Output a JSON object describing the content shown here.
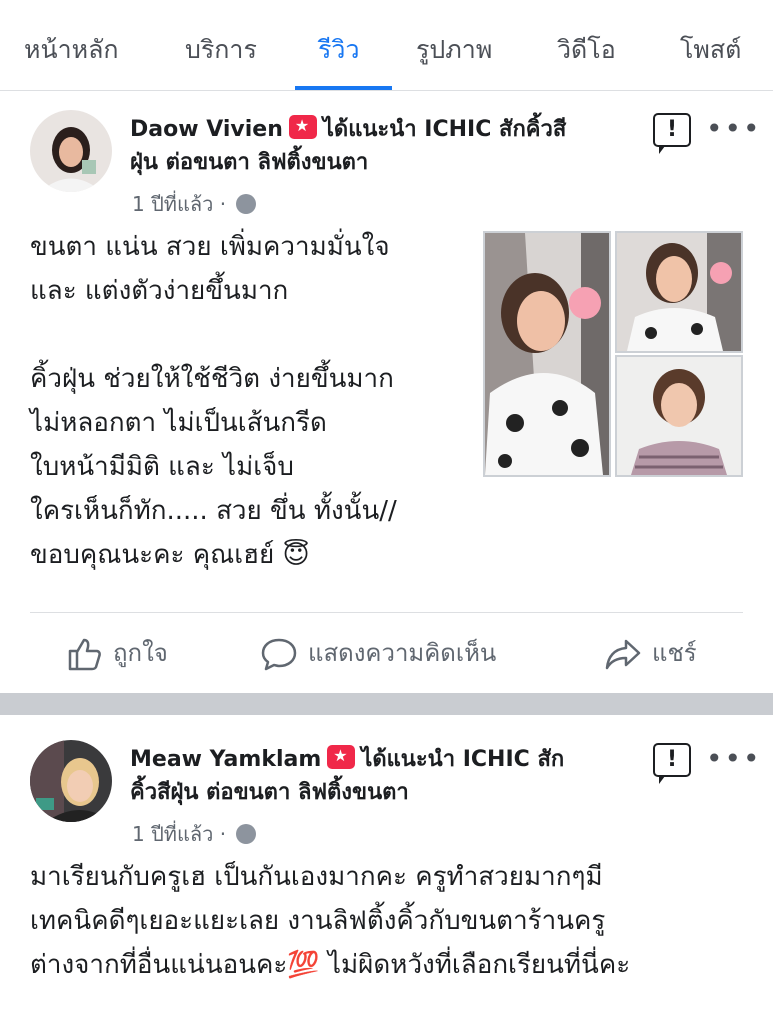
{
  "tabs": [
    {
      "label": "หน้าหลัก"
    },
    {
      "label": "บริการ"
    },
    {
      "label": "รีวิว",
      "active": true
    },
    {
      "label": "รูปภาพ"
    },
    {
      "label": "วิดีโอ"
    },
    {
      "label": "โพสต์"
    }
  ],
  "posts": [
    {
      "author": "Daow Vivien",
      "recommendation": "ได้แนะนำ ICHIC สักคิ้วสี",
      "recommendation_cont": "ฝุ่น ต่อขนตา ลิฟติ้งขนตา",
      "time": "1 ปีที่แล้ว ·",
      "text": "ขนตา แน่น สวย เพิ่มความมั่นใจ\nและ แต่งตัวง่ายขึ้นมาก\n\nคิ้วฝุ่น ช่วยให้ใช้ชีวิต ง่ายขึ้นมาก\nไม่หลอกตา ไม่เป็นเส้นกรีด\nใบหน้ามีมิติ และ ไม่เจ็บ\nใครเห็นก็ทัก..... สวย ขึ่น ทั้งนั้น//\nขอบคุณนะคะ คุณเฮย์ 😇",
      "photos": 3
    },
    {
      "author": "Meaw Yamklam",
      "recommendation": "ได้แนะนำ ICHIC สัก",
      "recommendation_cont": "คิ้วสีฝุ่น ต่อขนตา ลิฟติ้งขนตา",
      "time": "1 ปีที่แล้ว ·",
      "text": "มาเรียนกับครูเฮ เป็นกันเองมากคะ  ครูทำสวยมากๆมี\nเทคนิคดีๆเยอะแยะเลย งานลิฟติ้งคิ้วกับขนตาร้านครู\nต่างจากที่อื่นแน่นอนคะ💯 ไม่ผิดหวังที่เลือกเรียนที่นี่คะ"
    }
  ],
  "actions": {
    "like": "ถูกใจ",
    "comment": "แสดงความคิดเห็น",
    "share": "แชร์"
  },
  "icons": {
    "like": "thumbs-up-icon",
    "comment": "comment-bubble-icon",
    "share": "share-arrow-icon",
    "globe": "globe-icon",
    "report": "report-flag-icon",
    "more": "more-dots-icon"
  },
  "colors": {
    "accent": "#1877f2",
    "recommend_badge": "#f02849",
    "separator": "#c9ccd1"
  }
}
